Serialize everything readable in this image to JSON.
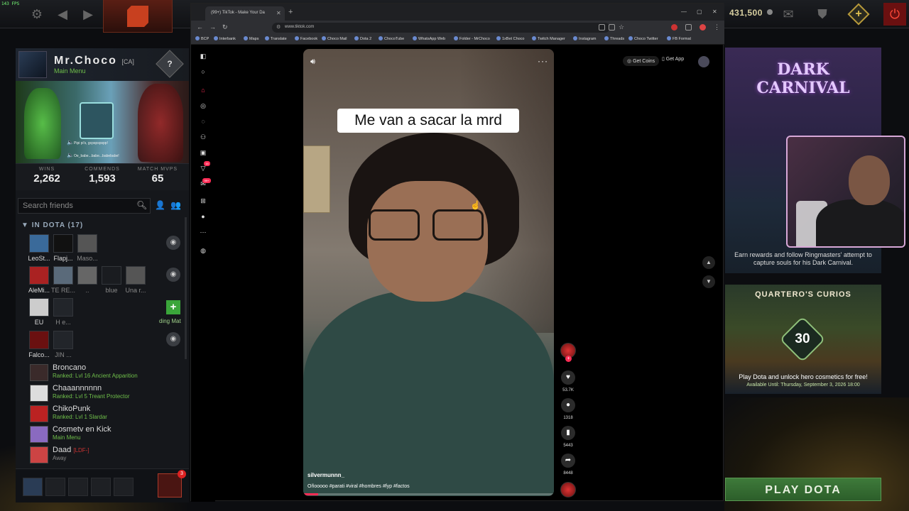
{
  "dota": {
    "fps": "143 FPS",
    "gold": "431,500",
    "play_button": "PLAY DOTA"
  },
  "profile": {
    "name": "Mr.Choco",
    "tag": "[CA]",
    "status": "Main Menu",
    "voice_lines": [
      "Pipi pi's, gcpspspspp!",
      "Oe_babe...babe...babebabe!"
    ],
    "stats": [
      {
        "label": "WINS",
        "value": "2,262"
      },
      {
        "label": "COMMENDS",
        "value": "1,593"
      },
      {
        "label": "MATCH MVPS",
        "value": "65"
      }
    ]
  },
  "friends": {
    "search_placeholder": "Search friends",
    "group_label": "IN DOTA",
    "group_count": "(17)",
    "tiles": [
      {
        "name": "LeoSt..."
      },
      {
        "name": "Flapj..."
      },
      {
        "name": "Maso..."
      },
      {
        "name": "AleMi..."
      },
      {
        "name": "TE RE..."
      },
      {
        "name": ".."
      },
      {
        "name": "blue"
      },
      {
        "name": "Una r..."
      },
      {
        "name": "EU"
      },
      {
        "name": "H e..."
      },
      {
        "name": "Falco..."
      },
      {
        "name": "JIN ..."
      }
    ],
    "finding_match": "ding Mat",
    "rows": [
      {
        "name": "Broncano",
        "tag": "",
        "status": "Ranked: Lvl 16 Ancient Apparition"
      },
      {
        "name": "Chaaannnnnn",
        "tag": "",
        "status": "Ranked: Lvl 5 Treant Protector"
      },
      {
        "name": "ChikoPunk",
        "tag": "",
        "status": "Ranked: Lvl 1 Slardar"
      },
      {
        "name": "Cosmetv en Kick",
        "tag": "",
        "status": "Main Menu"
      },
      {
        "name": "Daad",
        "tag": "[LDF-]",
        "status": "Away"
      }
    ],
    "party_badge": "3"
  },
  "browser": {
    "tab_title": "(99+) TikTok - Make Your Da",
    "url": "www.tiktok.com",
    "bookmarks": [
      "BCP",
      "Interbank",
      "Maps",
      "Translate",
      "Facebook",
      "Choco Mail",
      "Dota 2",
      "ChocoTube",
      "WhatsApp Web",
      "Folder - MrChoco",
      "1xBet Choco",
      "Twitch Manager",
      "Instagram",
      "Threads",
      "Choco Twitter",
      "FB Format"
    ]
  },
  "tiktok": {
    "caption": "Me van a sacar la mrd",
    "author": "silvermunnn_",
    "description": "Oñooooo #parati #viral #hombres #fyp #factos",
    "get_coins": "Get Coins",
    "get_app": "Get App",
    "inbox_badge": "16",
    "messages_badge": "99+",
    "likes": "53.7K",
    "comments": "1318",
    "saves": "5443",
    "shares": "8448",
    "progress": 0.06
  },
  "event": {
    "title": "DARK CARNIVAL",
    "description": "Earn rewards and follow Ringmasters' attempt to capture souls for his Dark Carnival."
  },
  "curios": {
    "title": "QUARTERO'S CURIOS",
    "badge": "30",
    "description": "Play Dota and unlock hero cosmetics for free!",
    "available_until": "Available Until:  Thursday, September 3, 2026 18:00"
  }
}
